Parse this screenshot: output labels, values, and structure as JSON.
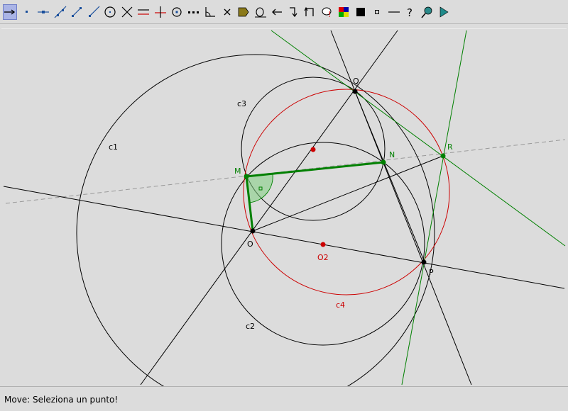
{
  "toolbar": {
    "tools": [
      {
        "icon": "move-arrow-icon",
        "selected": true
      },
      {
        "icon": "new-point-icon"
      },
      {
        "icon": "point-on-object-icon"
      },
      {
        "icon": "line-through-two-points-icon"
      },
      {
        "icon": "segment-icon"
      },
      {
        "icon": "ray-icon"
      },
      {
        "icon": "circle-icon"
      },
      {
        "icon": "intersect-icon"
      },
      {
        "icon": "parallel-line-icon"
      },
      {
        "icon": "perpendicular-line-icon"
      },
      {
        "icon": "midpoint-icon"
      },
      {
        "icon": "dotted-line-icon"
      },
      {
        "icon": "angle-icon"
      },
      {
        "icon": "delete-icon"
      },
      {
        "icon": "polygon-icon"
      },
      {
        "icon": "locus-icon"
      },
      {
        "icon": "undo-arrow-icon"
      },
      {
        "icon": "transform-icon"
      },
      {
        "icon": "reflect-icon"
      },
      {
        "icon": "macro-icon"
      },
      {
        "icon": "color-palette-icon"
      },
      {
        "icon": "black-square-icon"
      },
      {
        "icon": "small-point-style-icon"
      },
      {
        "icon": "line-style-icon"
      },
      {
        "icon": "help-icon"
      },
      {
        "icon": "zoom-icon"
      },
      {
        "icon": "play-icon"
      }
    ],
    "help_glyph": "?"
  },
  "canvas": {
    "labels": {
      "Q": "Q",
      "N": "N",
      "M": "M",
      "R": "R",
      "O": "O",
      "O2": "O2",
      "P": "P",
      "c1": "c1",
      "c2": "c2",
      "c3": "c3",
      "c4": "c4"
    },
    "colors": {
      "black": "#000000",
      "red": "#cc0000",
      "green": "#008000",
      "gray_dashed": "#999999"
    }
  },
  "status": {
    "message": "Move: Seleziona un punto!"
  }
}
